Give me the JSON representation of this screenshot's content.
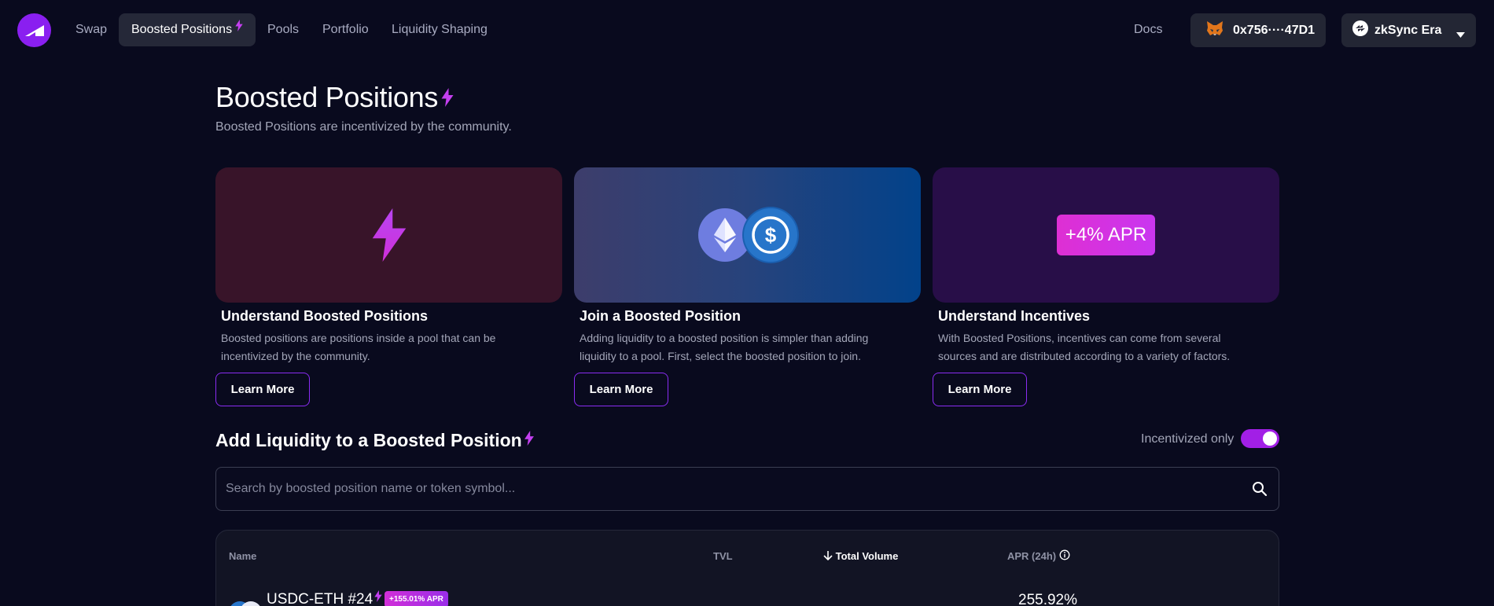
{
  "nav": {
    "items": [
      {
        "label": "Swap",
        "active": false
      },
      {
        "label": "Boosted Positions",
        "active": true
      },
      {
        "label": "Pools",
        "active": false
      },
      {
        "label": "Portfolio",
        "active": false
      },
      {
        "label": "Liquidity Shaping",
        "active": false
      }
    ],
    "docs_label": "Docs",
    "wallet_address": "0x756····47D1",
    "network_label": "zkSync Era"
  },
  "header": {
    "title": "Boosted Positions",
    "subtitle": "Boosted Positions are incentivized by the community."
  },
  "cards": [
    {
      "title": "Understand Boosted Positions",
      "description": "Boosted positions are positions inside a pool that can be incentivized by the community.",
      "button": "Learn More"
    },
    {
      "title": "Join a Boosted Position",
      "description": "Adding liquidity to a boosted position is simpler than adding liquidity to a pool. First, select the boosted position to join.",
      "button": "Learn More"
    },
    {
      "title": "Understand Incentives",
      "description": "With Boosted Positions, incentives can come from several sources and are distributed according to a variety of factors.",
      "button": "Learn More",
      "media_badge": "+4% APR"
    }
  ],
  "section": {
    "title": "Add Liquidity to a Boosted Position",
    "toggle_label": "Incentivized only",
    "toggle_on": true
  },
  "search": {
    "placeholder": "Search by boosted position name or token symbol..."
  },
  "table": {
    "columns": [
      "Name",
      "TVL",
      "Total Volume",
      "APR (24h)"
    ],
    "sorted_column": "Total Volume",
    "rows": [
      {
        "name": "USDC-ETH #24",
        "apr_badge": "+155.01% APR",
        "apr": "255.92%"
      }
    ]
  },
  "colors": {
    "background": "#090a1e",
    "accent": "#8a2cf2",
    "toggle": "#a21fe6",
    "card1": "#381429",
    "card3": "#280e48"
  }
}
